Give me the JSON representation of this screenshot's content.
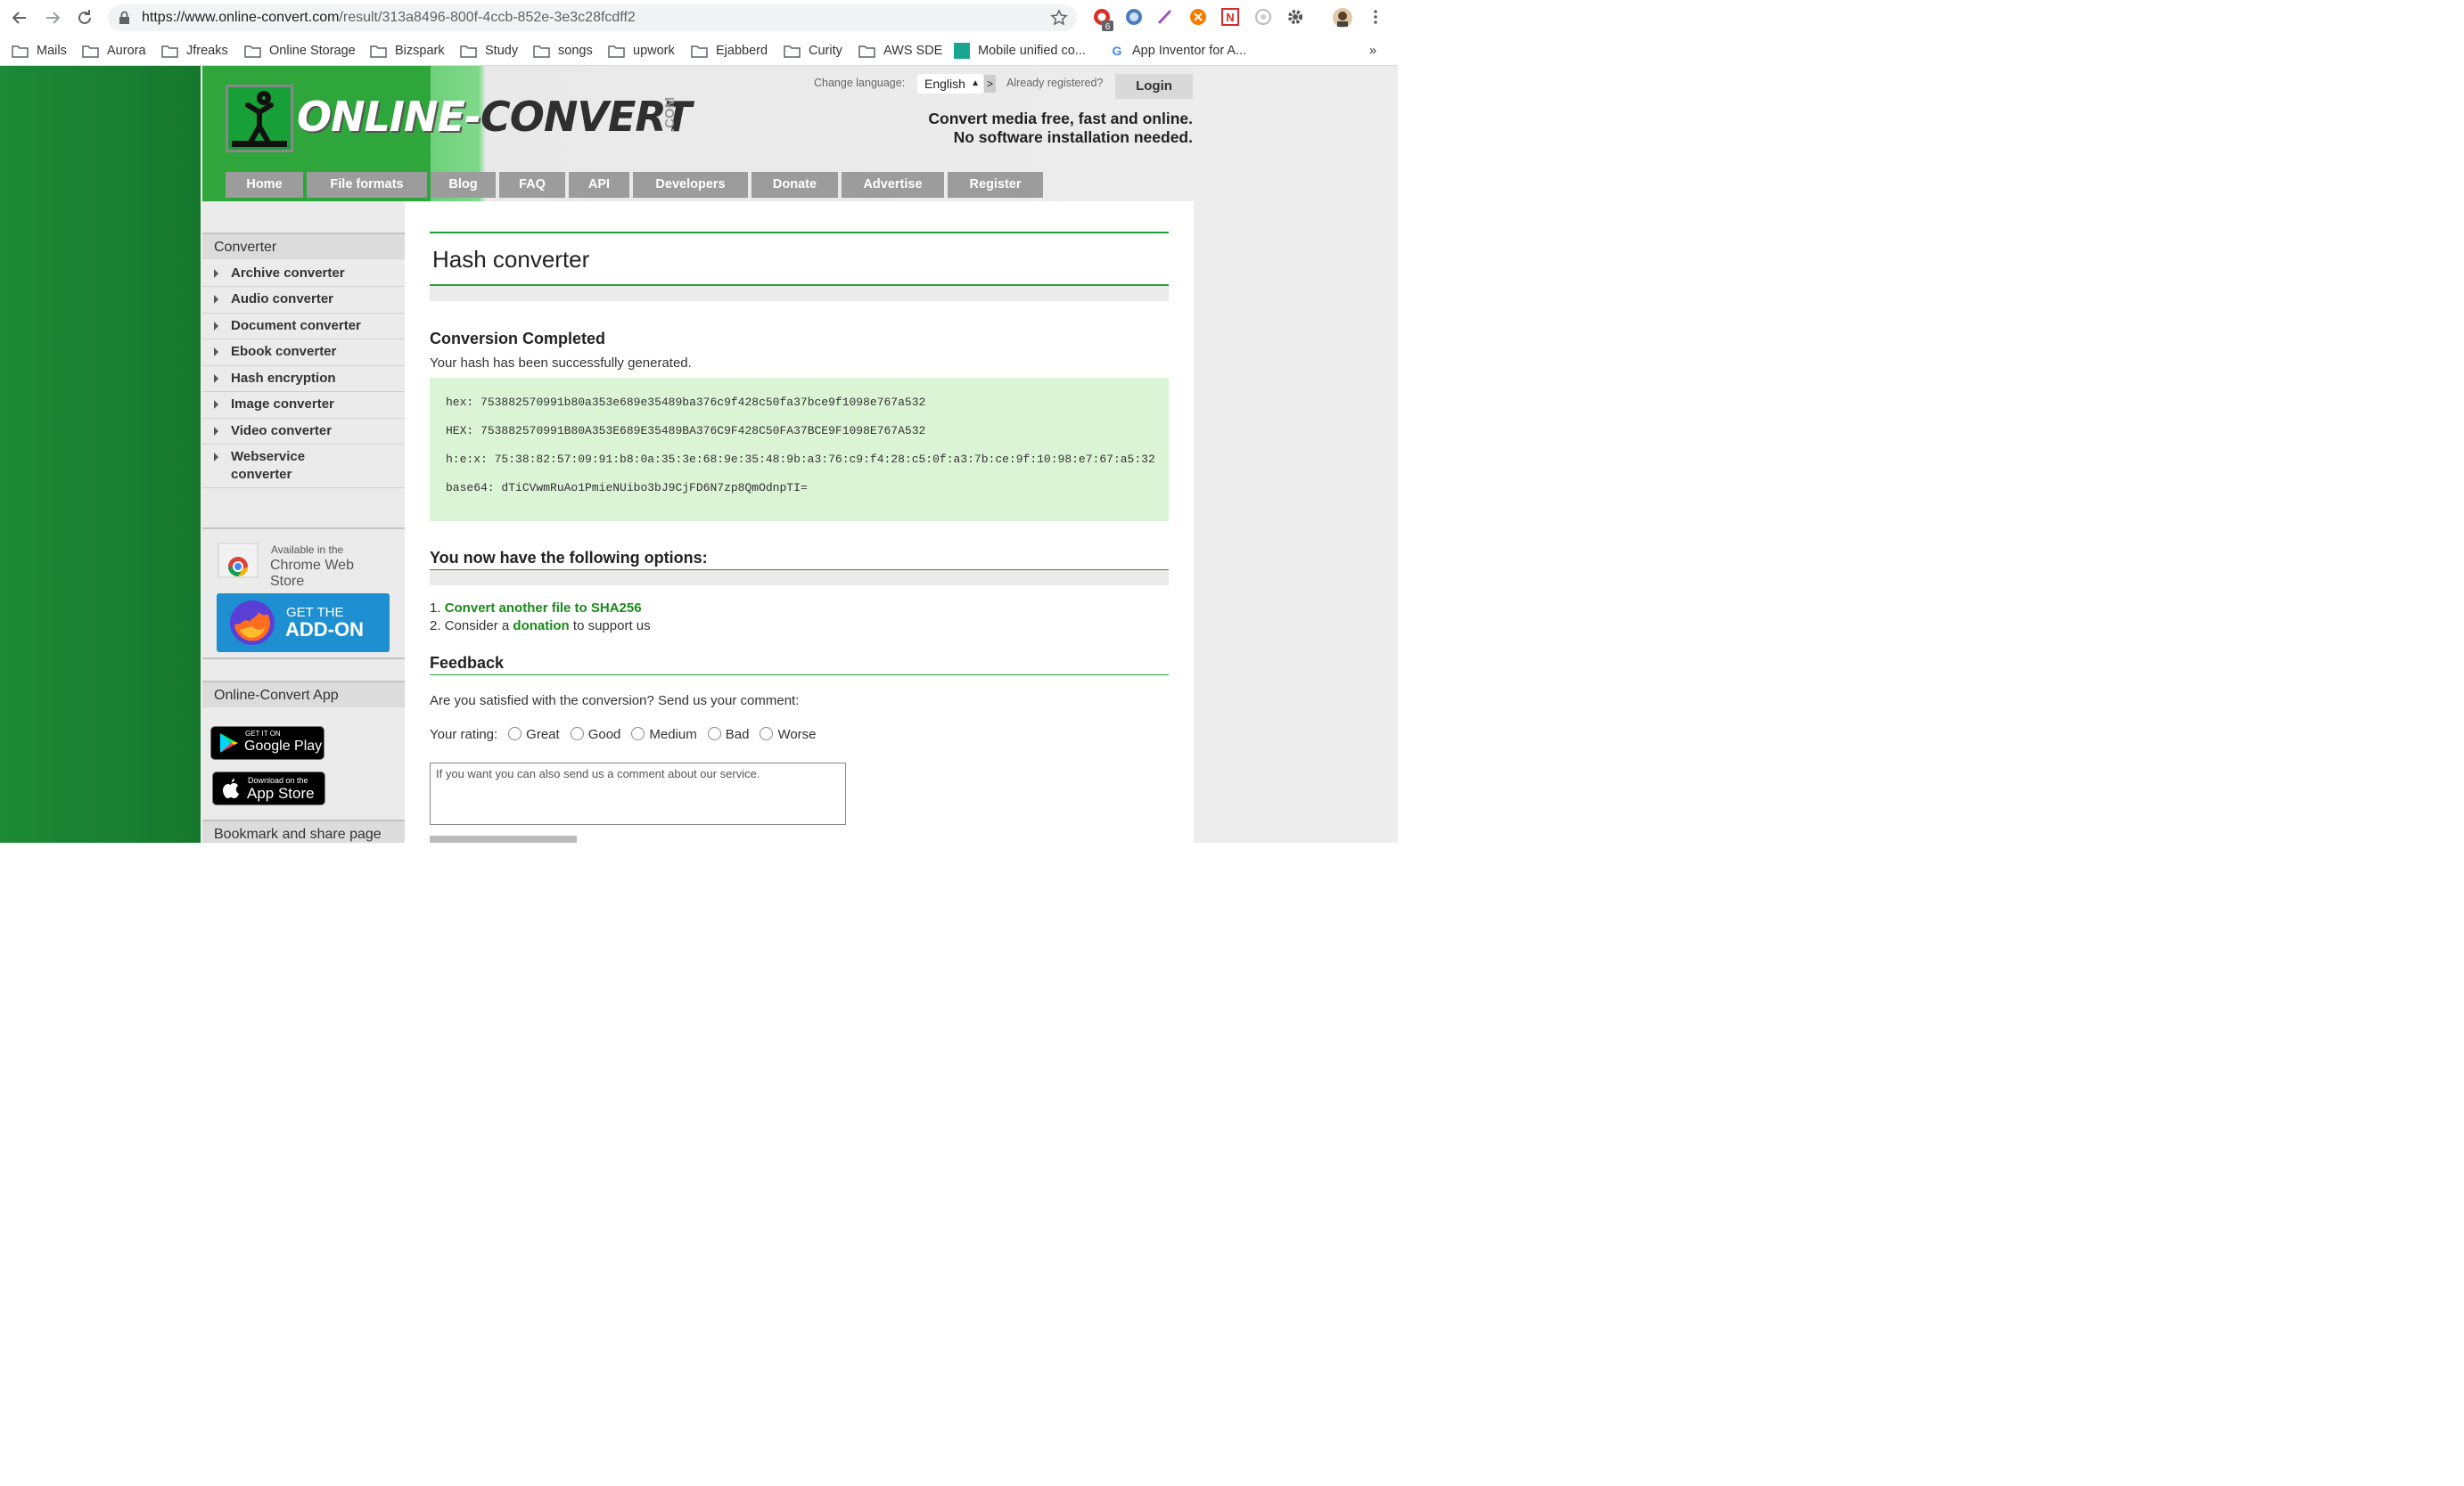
{
  "browser": {
    "url_host": "https://www.online-convert.com",
    "url_path": "/result/313a8496-800f-4ccb-852e-3e3c28fcdff2",
    "extension_badge": "6"
  },
  "bookmarks": [
    {
      "label": "Mails"
    },
    {
      "label": "Aurora"
    },
    {
      "label": "Jfreaks"
    },
    {
      "label": "Online Storage"
    },
    {
      "label": "Bizspark"
    },
    {
      "label": "Study"
    },
    {
      "label": "songs"
    },
    {
      "label": "upwork"
    },
    {
      "label": "Ejabberd"
    },
    {
      "label": "Curity"
    },
    {
      "label": "AWS SDE"
    },
    {
      "label": "Mobile unified co..."
    },
    {
      "label": "App Inventor for A..."
    }
  ],
  "bookmarks_overflow": "»",
  "header": {
    "logo_text_a": "ONLINE-",
    "logo_text_b": "CONVERT",
    "logo_com": ".COM",
    "change_language_label": "Change language:",
    "language_value": "English",
    "language_go": ">",
    "already_registered": "Already registered?",
    "login_label": "Login",
    "tagline_1": "Convert media free, fast and online.",
    "tagline_2": "No software installation needed."
  },
  "menu": [
    {
      "label": "Home"
    },
    {
      "label": "File formats"
    },
    {
      "label": "Blog"
    },
    {
      "label": "FAQ"
    },
    {
      "label": "API"
    },
    {
      "label": "Developers"
    },
    {
      "label": "Donate"
    },
    {
      "label": "Advertise"
    },
    {
      "label": "Register"
    }
  ],
  "sidebar": {
    "converter_heading": "Converter",
    "items": [
      {
        "label": "Archive converter"
      },
      {
        "label": "Audio converter"
      },
      {
        "label": "Document converter"
      },
      {
        "label": "Ebook converter"
      },
      {
        "label": "Hash encryption"
      },
      {
        "label": "Image converter"
      },
      {
        "label": "Video converter"
      },
      {
        "label": "Webservice converter"
      }
    ],
    "chrome_badge_small": "Available in the",
    "chrome_badge_big": "Chrome Web Store",
    "firefox_badge_small": "GET THE",
    "firefox_badge_big": "ADD-ON",
    "app_heading": "Online-Convert App",
    "google_play_small": "GET IT ON",
    "google_play_big": "Google Play",
    "app_store_small": "Download on the",
    "app_store_big": "App Store",
    "bookmark_heading": "Bookmark and share page"
  },
  "main": {
    "title": "Hash converter",
    "completed_heading": "Conversion Completed",
    "completed_text": "Your hash has been successfully generated.",
    "hashes": [
      {
        "label": "hex:",
        "value": "753882570991b80a353e689e35489ba376c9f428c50fa37bce9f1098e767a532"
      },
      {
        "label": "HEX:",
        "value": "753882570991B80A353E689E35489BA376C9F428C50FA37BCE9F1098E767A532"
      },
      {
        "label": "h:e:x:",
        "value": "75:38:82:57:09:91:b8:0a:35:3e:68:9e:35:48:9b:a3:76:c9:f4:28:c5:0f:a3:7b:ce:9f:10:98:e7:67:a5:32"
      },
      {
        "label": "base64:",
        "value": "dTiCVwmRuAo1PmieNUibo3bJ9CjFD6N7zp8QmOdnpTI="
      }
    ],
    "options_heading": "You now have the following options:",
    "option1_num": "1.",
    "option1_link": "Convert another file to SHA256",
    "option2_num": "2.",
    "option2_pre": "Consider a",
    "option2_link": "donation",
    "option2_post": "to support us",
    "feedback_heading": "Feedback",
    "feedback_question": "Are you satisfied with the conversion? Send us your comment:",
    "rating_label": "Your rating:",
    "ratings": [
      {
        "label": "Great"
      },
      {
        "label": "Good"
      },
      {
        "label": "Medium"
      },
      {
        "label": "Bad"
      },
      {
        "label": "Worse"
      }
    ],
    "comment_placeholder": "If you want you can also send us a comment about our service."
  },
  "colors": {
    "brand_green": "#22a03a",
    "link_green": "#1a8a1a",
    "hash_bg": "#dcf4d6",
    "menu_gray": "#9c9c9c"
  }
}
